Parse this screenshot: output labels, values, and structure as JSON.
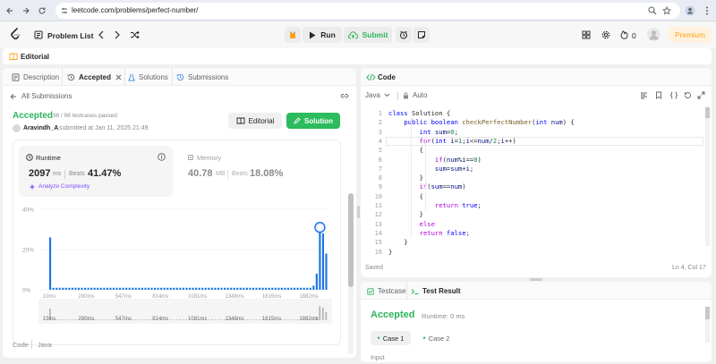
{
  "browser": {
    "url": "leetcode.com/problems/perfect-number/"
  },
  "appnav": {
    "problem_list": "Problem List",
    "run": "Run",
    "submit": "Submit",
    "streak_count": "0",
    "premium": "Premium"
  },
  "editorial_strip": {
    "label": "Editorial"
  },
  "left_tabs": [
    {
      "label": "Description"
    },
    {
      "label": "Accepted"
    },
    {
      "label": "Solutions"
    },
    {
      "label": "Submissions"
    }
  ],
  "submission": {
    "back_label": "All Submissions",
    "status": "Accepted",
    "testcases": "98 / 98 testcases passed",
    "author": "Aravindh_A",
    "submitted_at": "submitted at Jan 11, 2025 21:49",
    "editorial_btn": "Editorial",
    "solution_btn": "Solution",
    "runtime_label": "Runtime",
    "runtime_value": "2097",
    "runtime_unit": "ms",
    "runtime_beats_label": "Beats",
    "runtime_beats": "41.47%",
    "analyze": "Analyze Complexity",
    "memory_label": "Memory",
    "memory_value": "40.78",
    "memory_unit": "MB",
    "memory_beats_label": "Beats",
    "memory_beats": "18.08%",
    "code_label": "Code",
    "lang_label": "Java"
  },
  "chart_data": {
    "type": "bar",
    "ylabel": "",
    "xlabel": "",
    "y_ticks": [
      "40%",
      "20%",
      "0%"
    ],
    "ylim": [
      0,
      40
    ],
    "x_ticks": [
      "10ms",
      "280ms",
      "547ms",
      "814ms",
      "1081ms",
      "1348ms",
      "1615ms",
      "1882ms"
    ],
    "minimap_ticks": [
      "13ms",
      "280ms",
      "547ms",
      "814ms",
      "1081ms",
      "1348ms",
      "1615ms",
      "1882ms"
    ],
    "values": [
      26,
      1,
      1,
      1,
      1,
      1,
      1,
      1,
      1,
      1,
      1,
      1,
      1,
      1,
      1,
      1,
      1,
      1,
      1,
      1,
      1,
      1,
      1,
      1,
      1,
      1,
      1,
      1,
      1,
      1,
      1,
      1,
      1,
      1,
      1,
      1,
      1,
      1,
      1,
      1,
      1,
      1,
      1,
      1,
      1,
      1,
      1,
      1,
      1,
      1,
      1,
      1,
      1,
      1,
      1,
      1,
      1,
      1,
      1,
      1,
      1,
      1,
      1,
      1,
      1,
      1,
      1,
      1,
      1,
      1,
      1,
      1,
      1,
      1,
      1,
      1,
      1,
      1,
      1,
      1,
      1,
      1,
      1,
      2,
      8,
      31,
      28,
      18
    ],
    "highlight_index": 85
  },
  "code_panel": {
    "title": "Code",
    "language": "Java",
    "mode": "Auto",
    "saved": "Saved",
    "cursor": "Ln 4, Col 17",
    "lines": [
      [
        {
          "t": "class ",
          "c": "kw"
        },
        {
          "t": "Solution ",
          "c": "op"
        },
        {
          "t": "{",
          "c": "op"
        }
      ],
      [
        {
          "t": "    public ",
          "c": "kw"
        },
        {
          "t": "boolean ",
          "c": "kw"
        },
        {
          "t": "checkPerfectNumber",
          "c": "fn"
        },
        {
          "t": "(",
          "c": "op"
        },
        {
          "t": "int ",
          "c": "kw"
        },
        {
          "t": "num",
          "c": "plain"
        },
        {
          "t": ") {",
          "c": "op"
        }
      ],
      [
        {
          "t": "        int ",
          "c": "kw"
        },
        {
          "t": "sum",
          "c": "plain"
        },
        {
          "t": "=",
          "c": "op"
        },
        {
          "t": "0",
          "c": "num"
        },
        {
          "t": ";",
          "c": "op"
        }
      ],
      [
        {
          "t": "        for",
          "c": "kw2"
        },
        {
          "t": "(",
          "c": "op"
        },
        {
          "t": "int ",
          "c": "kw"
        },
        {
          "t": "i",
          "c": "plain"
        },
        {
          "t": "=",
          "c": "op"
        },
        {
          "t": "1",
          "c": "num"
        },
        {
          "t": ";",
          "c": "op"
        },
        {
          "t": "i",
          "c": "plain"
        },
        {
          "t": "<=",
          "c": "op"
        },
        {
          "t": "num",
          "c": "plain"
        },
        {
          "t": "/",
          "c": "op"
        },
        {
          "t": "2",
          "c": "num"
        },
        {
          "t": ";",
          "c": "op"
        },
        {
          "t": "i",
          "c": "plain"
        },
        {
          "t": "++)",
          "c": "op"
        }
      ],
      [
        {
          "t": "        {",
          "c": "op"
        }
      ],
      [
        {
          "t": "            if",
          "c": "kw2"
        },
        {
          "t": "(",
          "c": "op"
        },
        {
          "t": "num",
          "c": "plain"
        },
        {
          "t": "%",
          "c": "op"
        },
        {
          "t": "i",
          "c": "plain"
        },
        {
          "t": "==",
          "c": "op"
        },
        {
          "t": "0",
          "c": "num"
        },
        {
          "t": ")",
          "c": "op"
        }
      ],
      [
        {
          "t": "            sum",
          "c": "plain"
        },
        {
          "t": "=",
          "c": "op"
        },
        {
          "t": "sum",
          "c": "plain"
        },
        {
          "t": "+",
          "c": "op"
        },
        {
          "t": "i",
          "c": "plain"
        },
        {
          "t": ";",
          "c": "op"
        }
      ],
      [
        {
          "t": "        }",
          "c": "op"
        }
      ],
      [
        {
          "t": "        if",
          "c": "kw2"
        },
        {
          "t": "(",
          "c": "op"
        },
        {
          "t": "sum",
          "c": "plain"
        },
        {
          "t": "==",
          "c": "op"
        },
        {
          "t": "num",
          "c": "plain"
        },
        {
          "t": ")",
          "c": "op"
        }
      ],
      [
        {
          "t": "        {",
          "c": "op"
        }
      ],
      [
        {
          "t": "            return ",
          "c": "kw2"
        },
        {
          "t": "true",
          "c": "kw"
        },
        {
          "t": ";",
          "c": "op"
        }
      ],
      [
        {
          "t": "        }",
          "c": "op"
        }
      ],
      [
        {
          "t": "        else",
          "c": "kw2"
        }
      ],
      [
        {
          "t": "        return ",
          "c": "kw2"
        },
        {
          "t": "false",
          "c": "kw"
        },
        {
          "t": ";",
          "c": "op"
        }
      ],
      [
        {
          "t": "    }",
          "c": "op"
        }
      ],
      [
        {
          "t": "}",
          "c": "op"
        }
      ]
    ]
  },
  "test_panel": {
    "tab_testcase": "Testcase",
    "tab_result": "Test Result",
    "status": "Accepted",
    "runtime": "Runtime: 0 ms",
    "case1": "Case 1",
    "case2": "Case 2",
    "input_label": "Input"
  },
  "colors": {
    "accent_green": "#2db55d",
    "solution_btn": "#2cbb5d",
    "premium": "#ffa116",
    "bar_blue": "#1a73e8"
  }
}
